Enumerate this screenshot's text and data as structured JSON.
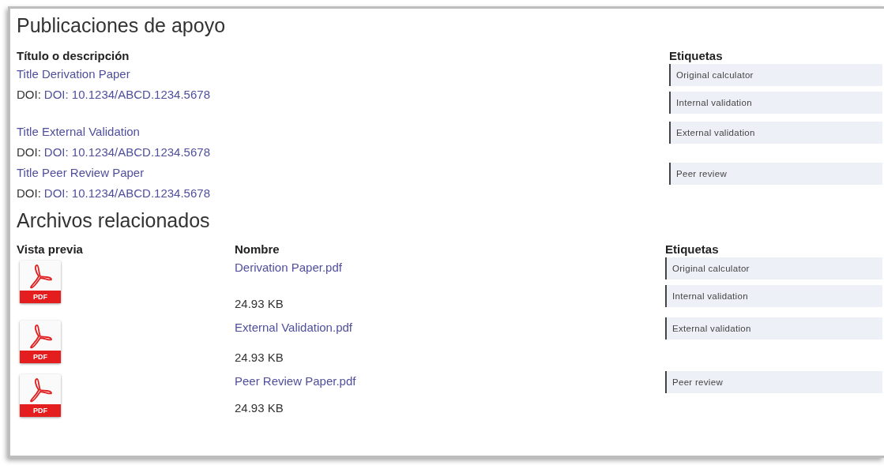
{
  "publications": {
    "title": "Publicaciones de apoyo",
    "columns": [
      "Título o descripción",
      "Etiquetas"
    ],
    "items": [
      {
        "title": "Title Derivation Paper",
        "doi_label": "DOI:",
        "doi": "DOI: 10.1234/ABCD.1234.5678",
        "tags": [
          "Original calculator",
          "Internal validation"
        ]
      },
      {
        "title": "Title External Validation",
        "doi_label": "DOI:",
        "doi": "DOI: 10.1234/ABCD.1234.5678",
        "tags": [
          "External validation"
        ]
      },
      {
        "title": "Title Peer Review Paper",
        "doi_label": "DOI:",
        "doi": "DOI: 10.1234/ABCD.1234.5678",
        "tags": [
          "Peer review"
        ]
      }
    ]
  },
  "files": {
    "title": "Archivos relacionados",
    "columns": [
      "Vista previa",
      "Nombre",
      "Etiquetas"
    ],
    "items": [
      {
        "badge": "PDF",
        "name": "Derivation Paper.pdf",
        "size": "24.93 KB",
        "tags": [
          "Original calculator",
          "Internal validation"
        ]
      },
      {
        "badge": "PDF",
        "name": "External Validation.pdf",
        "size": "24.93 KB",
        "tags": [
          "External validation"
        ]
      },
      {
        "badge": "PDF",
        "name": "Peer Review Paper.pdf",
        "size": "24.93 KB",
        "tags": [
          "Peer review"
        ]
      }
    ]
  }
}
